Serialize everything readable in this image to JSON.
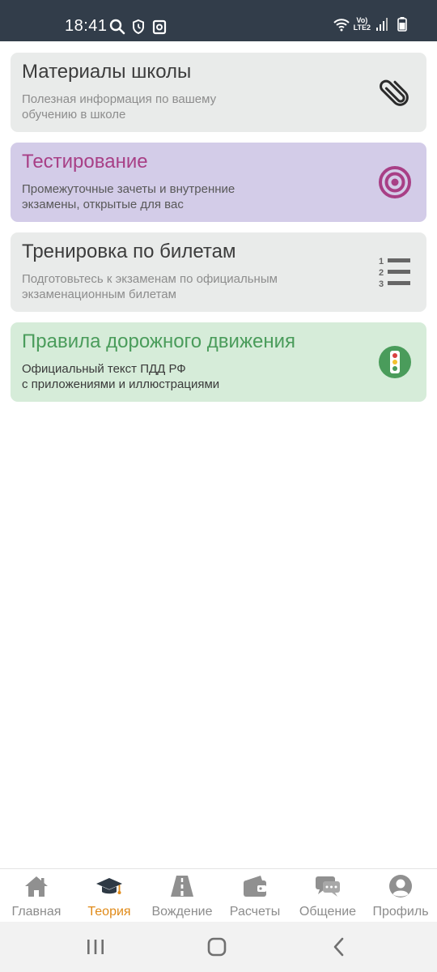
{
  "status_bar": {
    "time": "18:41",
    "left_icons": [
      "search-icon",
      "shield-clock-icon",
      "camera-box-icon"
    ],
    "right_icons": [
      "wifi-icon",
      "volte-icon",
      "signal-icon",
      "battery-icon"
    ],
    "lte_line1": "Vo)",
    "lte_line2": "LTE2"
  },
  "cards": [
    {
      "title": "Материалы школы",
      "description": "Полезная информация по вашему обучению в школе",
      "icon": "paperclip-icon",
      "background": "#e9ebea",
      "title_color": "#3c3c3c"
    },
    {
      "title": "Тестирование",
      "description": "Промежуточные зачеты и внутренние экзамены, открытые для вас",
      "icon": "target-icon",
      "background": "#d3cce8",
      "title_color": "#a83f86"
    },
    {
      "title": "Тренировка по билетам",
      "description": "Подготовьтесь к экзаменам по официальным экзаменационным билетам",
      "icon": "numbered-list-icon",
      "background": "#e9ebea",
      "title_color": "#3c3c3c"
    },
    {
      "title": "Правила дорожного движения",
      "description_line1": "Официальный текст ПДД РФ",
      "description_line2": "с приложениями и иллюстрациями",
      "icon": "traffic-light-icon",
      "background": "#d6ecd9",
      "title_color": "#4a9c5b"
    }
  ],
  "bottom_nav": {
    "active_color": "#e08a18",
    "inactive_color": "#8c8c8c",
    "items": [
      {
        "label": "Главная",
        "icon": "home-icon",
        "active": false
      },
      {
        "label": "Теория",
        "icon": "graduation-cap-icon",
        "active": true
      },
      {
        "label": "Вождение",
        "icon": "road-icon",
        "active": false
      },
      {
        "label": "Расчеты",
        "icon": "wallet-icon",
        "active": false
      },
      {
        "label": "Общение",
        "icon": "chat-icon",
        "active": false
      },
      {
        "label": "Профиль",
        "icon": "profile-icon",
        "active": false
      }
    ]
  },
  "system_nav": [
    "recent-apps-icon",
    "home-circle-icon",
    "back-icon"
  ]
}
